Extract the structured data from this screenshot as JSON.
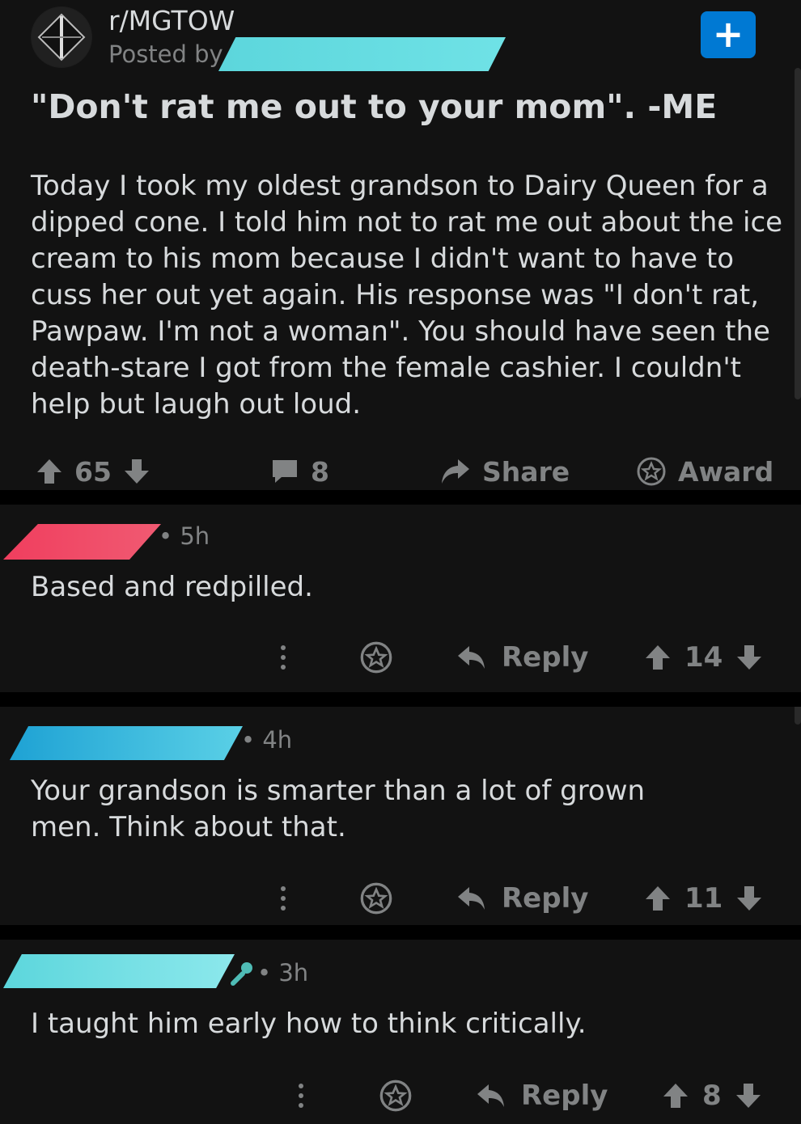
{
  "post": {
    "subreddit": "r/MGTOW",
    "posted_by": "Posted by u",
    "title": "\"Don't rat me out to your mom\". -ME",
    "body": "Today I took my oldest grandson to Dairy Queen for a dipped cone.  I told him not to rat me out about the ice cream to his mom because I didn't want to have to cuss her out yet again.  His response was \"I don't rat, Pawpaw.  I'm not a woman\".  You should have seen the death-stare I got from the female cashier.  I couldn't help but laugh out loud.",
    "score": "65",
    "comment_count": "8",
    "share_label": "Share",
    "award_label": "Award",
    "join_label": "+"
  },
  "comments": [
    {
      "age": "• 5h",
      "text": "Based and redpilled.",
      "reply_label": "Reply",
      "score": "14"
    },
    {
      "age": "• 4h",
      "text": "Your grandson is smarter than a lot of grown men. Think about that.",
      "reply_label": "Reply",
      "score": "11"
    },
    {
      "age": "• 3h",
      "text": "I taught him early how to think critically.",
      "reply_label": "Reply",
      "score": "8"
    }
  ],
  "colors": {
    "background": "#121212",
    "text": "#d7dadc",
    "muted": "#818384",
    "join_button": "#0079d3",
    "redaction_cyan": "#5cd6dc",
    "redaction_red": "#f04a64",
    "redaction_blue": "#1ea2d4"
  },
  "icons": [
    "subreddit-avatar-icon",
    "plus-icon",
    "upvote-icon",
    "downvote-icon",
    "comment-icon",
    "share-icon",
    "award-icon",
    "more-icon",
    "reply-icon",
    "mod-flair-icon"
  ]
}
